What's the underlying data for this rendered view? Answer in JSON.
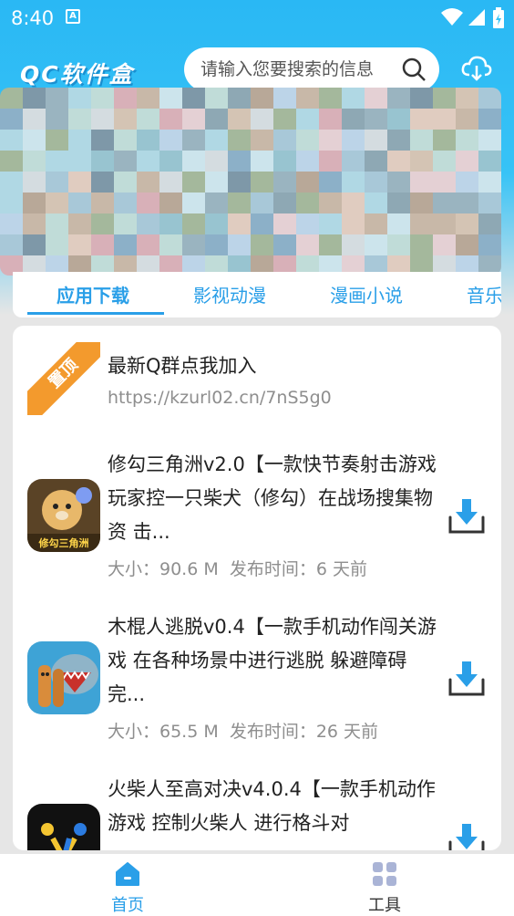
{
  "status_bar": {
    "time": "8:40",
    "notification_letter": "A"
  },
  "header": {
    "app_name": "QC软件盒",
    "search_placeholder": "请输入您要搜索的信息"
  },
  "tabs": [
    {
      "label": "应用下载",
      "active": true
    },
    {
      "label": "影视动漫",
      "active": false
    },
    {
      "label": "漫画小说",
      "active": false
    },
    {
      "label": "音乐",
      "active": false
    }
  ],
  "pinned": {
    "badge": "置顶",
    "title": "最新Q群点我加入",
    "url": "https://kzurl02.cn/7nS5g0"
  },
  "apps": [
    {
      "title": "修勾三角洲v2.0【一款快节奏射击游戏 玩家控一只柴犬（修勾）在战场搜集物资 击...",
      "size": "大小：90.6 M",
      "published": "发布时间：6 天前",
      "icon_label": "修勾三角洲"
    },
    {
      "title": "木棍人逃脱v0.4【一款手机动作闯关游戏 在各种场景中进行逃脱 躲避障碍 完...",
      "size": "大小：65.5 M",
      "published": "发布时间：26 天前"
    },
    {
      "title": "火柴人至高对决v4.0.4【一款手机动作游戏 控制火柴人 进行格斗对",
      "size": "",
      "published": ""
    }
  ],
  "bottom_nav": [
    {
      "label": "首页",
      "active": true
    },
    {
      "label": "工具",
      "active": false
    }
  ],
  "colors": {
    "accent": "#2a9fe8",
    "header": "#2ab8f4",
    "pin": "#f39a2d"
  }
}
